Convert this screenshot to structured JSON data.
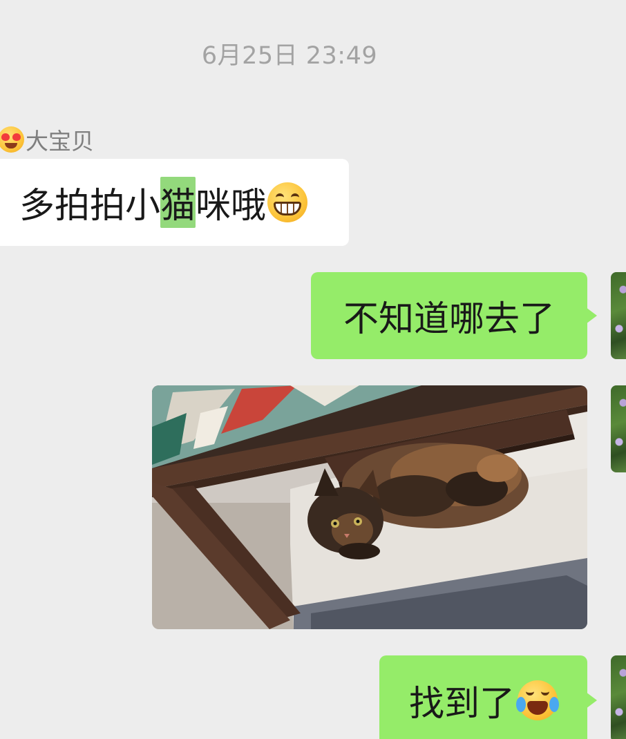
{
  "conversation": {
    "timestamp": "6月25日 23:49",
    "sender_name": "大宝贝",
    "sender_name_emoji": "heart-eyes-emoji",
    "messages": [
      {
        "id": 1,
        "direction": "incoming",
        "type": "text",
        "text_before": "多拍拍小",
        "highlighted": "猫",
        "text_after": "咪哦",
        "trailing_emoji": "grinning-teeth-emoji"
      },
      {
        "id": 2,
        "direction": "outgoing",
        "type": "text",
        "text": "不知道哪去了"
      },
      {
        "id": 3,
        "direction": "outgoing",
        "type": "image",
        "image_subject": "tortoiseshell cat lying on a white chair under a wooden desk"
      },
      {
        "id": 4,
        "direction": "outgoing",
        "type": "text",
        "text": "找到了",
        "trailing_emoji": "rolling-on-floor-laughing-crying-emoji"
      }
    ]
  },
  "colors": {
    "background": "#ededed",
    "incoming_bubble": "#ffffff",
    "outgoing_bubble": "#95ec69",
    "keyword_highlight": "#93d97c",
    "timestamp_text": "#a3a3a3",
    "sender_name_text": "#7f7f7f",
    "message_text": "#191919"
  }
}
